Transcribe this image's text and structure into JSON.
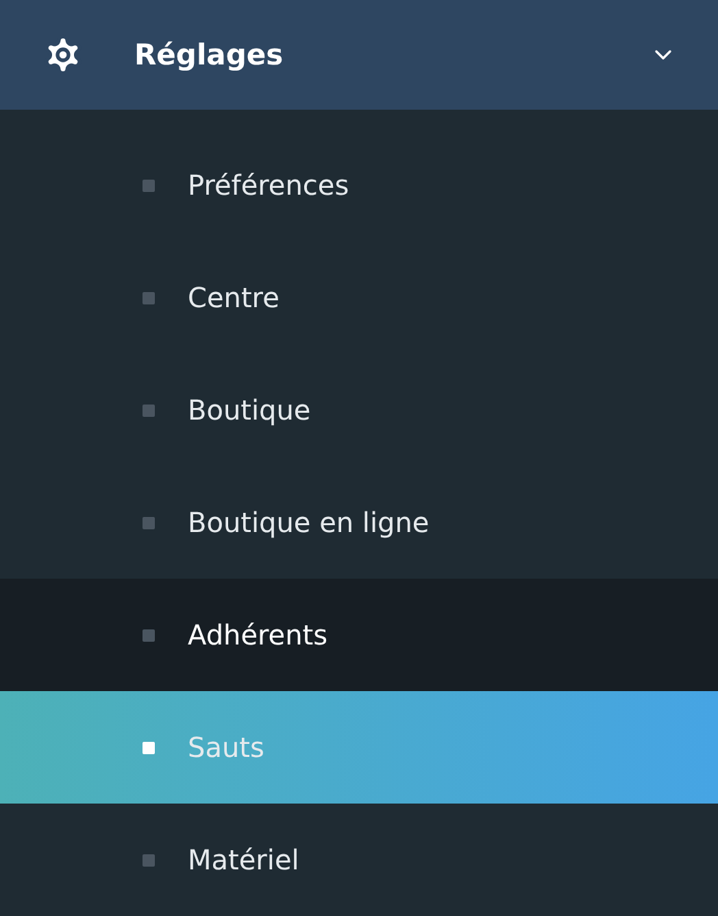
{
  "menu": {
    "title": "Réglages",
    "expanded": true,
    "items": [
      {
        "label": "Préférences",
        "selected": false,
        "hovered": false
      },
      {
        "label": "Centre",
        "selected": false,
        "hovered": false
      },
      {
        "label": "Boutique",
        "selected": false,
        "hovered": false
      },
      {
        "label": "Boutique en ligne",
        "selected": false,
        "hovered": false
      },
      {
        "label": "Adhérents",
        "selected": false,
        "hovered": true
      },
      {
        "label": "Sauts",
        "selected": true,
        "hovered": false
      },
      {
        "label": "Matériel",
        "selected": false,
        "hovered": false
      }
    ]
  }
}
